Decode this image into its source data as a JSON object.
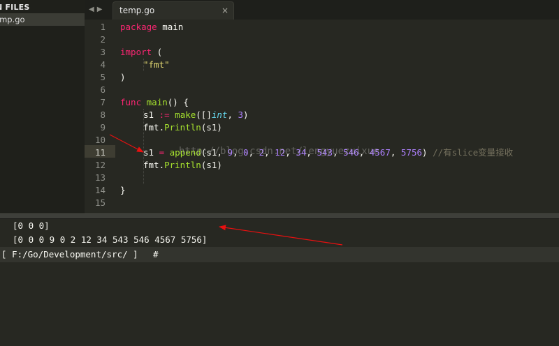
{
  "sidebar": {
    "header": "N FILES",
    "items": [
      {
        "label": "emp.go"
      }
    ]
  },
  "tabs": [
    {
      "label": "temp.go",
      "close_glyph": "×"
    }
  ],
  "nav": {
    "back_glyph": "◀",
    "forward_glyph": "▶"
  },
  "editor": {
    "line_numbers": [
      "1",
      "2",
      "3",
      "4",
      "5",
      "6",
      "7",
      "8",
      "9",
      "10",
      "11",
      "12",
      "13",
      "14",
      "15"
    ],
    "current_line": "11",
    "code": {
      "l1": {
        "kw": "package",
        "rest": " main"
      },
      "l3": {
        "kw": "import",
        "rest": " ("
      },
      "l4": {
        "str": "\"fmt\""
      },
      "l5": {
        "text": ")"
      },
      "l7": {
        "kw": "func",
        "fn": "main",
        "rest": "() {"
      },
      "l8": {
        "a": "s1 ",
        "op": ":=",
        "b": " ",
        "fn": "make",
        "c": "([]",
        "typ": "int",
        "d": ", ",
        "num": "3",
        "e": ")"
      },
      "l9": {
        "a": "fmt.",
        "fn": "Println",
        "b": "(s1)"
      },
      "l11": {
        "a": "s1 ",
        "op": "=",
        "b": " ",
        "fn": "append",
        "c": "(s1, ",
        "n1": "9",
        "d": ", ",
        "n2": "0",
        "e": ", ",
        "n3": "2",
        "f": ", ",
        "n4": "12",
        "g": ", ",
        "n5": "34",
        "h": ", ",
        "n6": "543",
        "i": ", ",
        "n7": "546",
        "j": ", ",
        "n8": "4567",
        "k": ", ",
        "n9": "5756",
        "l": ") ",
        "comment": "//有slice变量接收"
      },
      "l12": {
        "a": "fmt.",
        "fn": "Println",
        "b": "(s1)"
      },
      "l14": {
        "text": "}"
      }
    },
    "watermark": "http://blog.csdn.net/lengyuezuixue"
  },
  "console": {
    "output": [
      "[0 0 0]",
      "[0 0 0 9 0 2 12 34 543 546 4567 5756]"
    ],
    "prompt": "[ F:/Go/Development/src/ ]",
    "prompt_symbol": "#"
  },
  "colors": {
    "background": "#272822",
    "keyword": "#f92672",
    "string": "#e6db74",
    "function": "#a6e22e",
    "type": "#66d9ef",
    "number": "#ae81ff",
    "comment": "#75715e",
    "annotation_arrow": "#e81010"
  }
}
